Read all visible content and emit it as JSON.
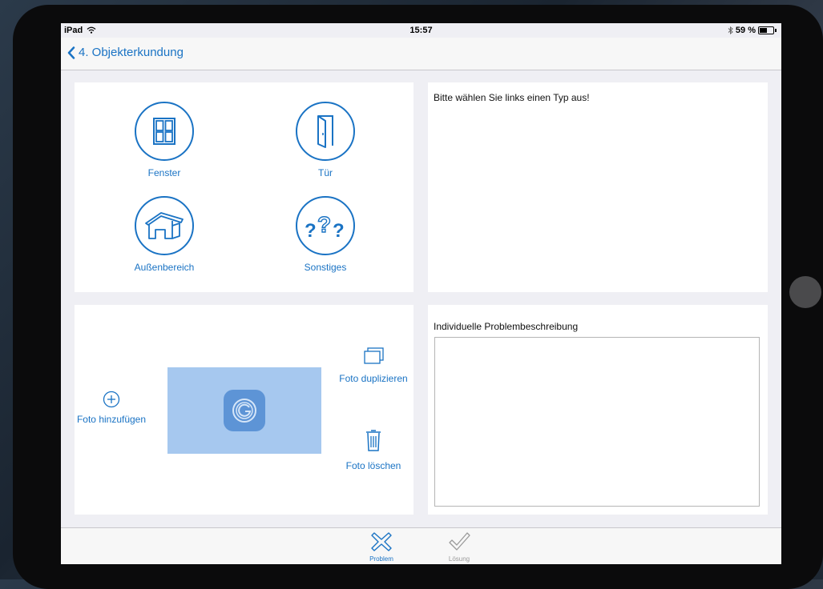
{
  "status_bar": {
    "device": "iPad",
    "time": "15:57",
    "battery_text": "59 %",
    "battery_level": 0.59
  },
  "nav": {
    "back_label": "4. Objekterkundung"
  },
  "types": [
    {
      "label": "Fenster",
      "icon": "window-icon"
    },
    {
      "label": "Tür",
      "icon": "door-icon"
    },
    {
      "label": "Außenbereich",
      "icon": "house-icon"
    },
    {
      "label": "Sonstiges",
      "icon": "question-marks-icon"
    }
  ],
  "hint_text": "Bitte wählen Sie links einen Typ aus!",
  "photo_actions": {
    "add": "Foto hinzufügen",
    "duplicate": "Foto duplizieren",
    "delete": "Foto löschen"
  },
  "description": {
    "label": "Individuelle Problembeschreibung",
    "value": ""
  },
  "tabs": [
    {
      "label": "Problem",
      "icon": "x-icon",
      "active": true
    },
    {
      "label": "Lösung",
      "icon": "checkmark-icon",
      "active": false
    }
  ],
  "colors": {
    "accent": "#1a73c4",
    "inactive": "#9a9a9a",
    "photo_placeholder": "#a6c8ef"
  }
}
